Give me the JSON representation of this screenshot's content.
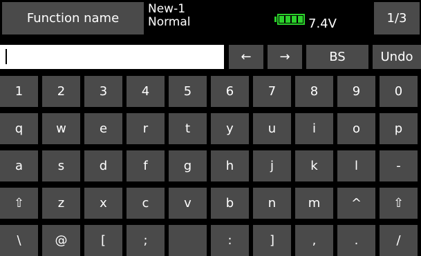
{
  "header": {
    "function_name_label": "Function name",
    "model_name": "New-1",
    "model_mode": "Normal",
    "battery_icon": "battery-icon",
    "battery_color": "#2bd12b",
    "voltage": "7.4V",
    "page_indicator": "1/3"
  },
  "input": {
    "value": ""
  },
  "toolbar": {
    "left_label": "←",
    "right_label": "→",
    "backspace_label": "BS",
    "undo_label": "Undo"
  },
  "keyboard": {
    "rows": [
      [
        "1",
        "2",
        "3",
        "4",
        "5",
        "6",
        "7",
        "8",
        "9",
        "0"
      ],
      [
        "q",
        "w",
        "e",
        "r",
        "t",
        "y",
        "u",
        "i",
        "o",
        "p"
      ],
      [
        "a",
        "s",
        "d",
        "f",
        "g",
        "h",
        "j",
        "k",
        "l",
        "-"
      ],
      [
        "⇧",
        "z",
        "x",
        "c",
        "v",
        "b",
        "n",
        "m",
        "^",
        "⇧"
      ],
      [
        "\\",
        "@",
        "[",
        ";",
        "",
        ":",
        "]",
        ",",
        ".",
        "/"
      ]
    ]
  }
}
